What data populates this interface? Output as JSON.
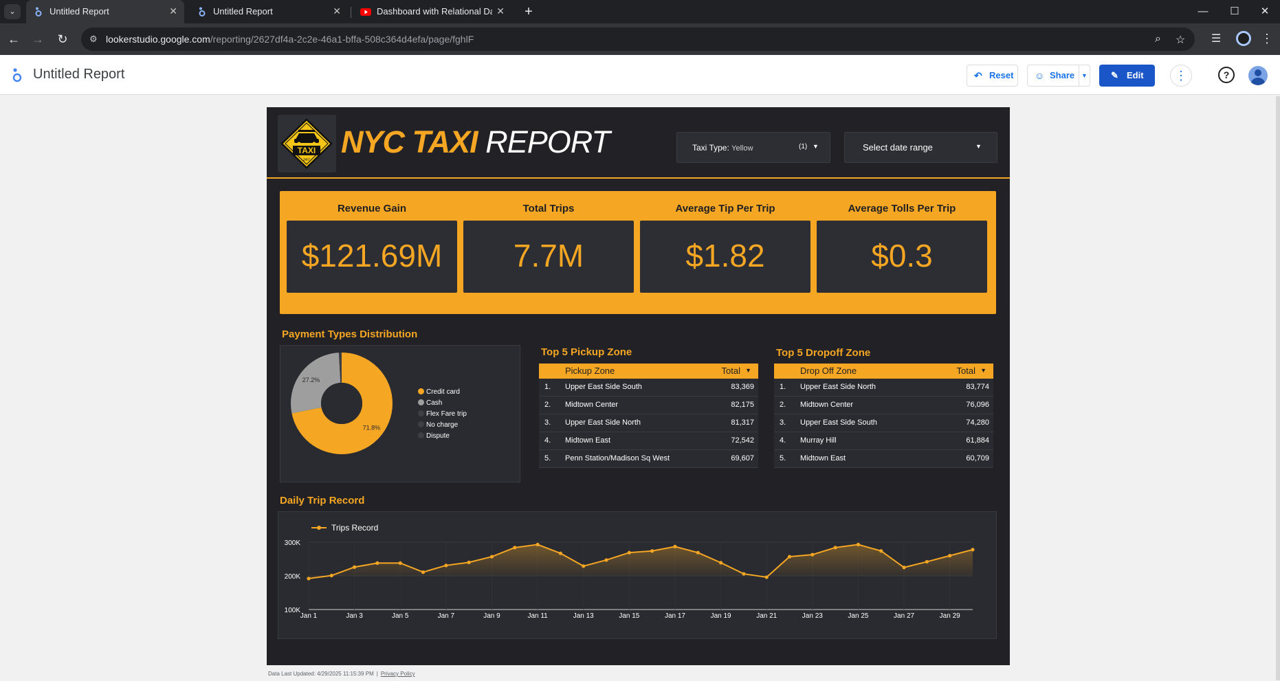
{
  "browser": {
    "tabs": [
      {
        "title": "Untitled Report",
        "active": true,
        "icon": "looker-studio-icon"
      },
      {
        "title": "Untitled Report",
        "active": false,
        "icon": "looker-studio-icon"
      },
      {
        "title": "Dashboard with Relational Data",
        "active": false,
        "icon": "youtube-icon"
      }
    ],
    "url_host": "lookerstudio.google.com",
    "url_path": "/reporting/2627df4a-2c2e-46a1-bffa-508c364d4efa/page/fghlF"
  },
  "app": {
    "title": "Untitled Report",
    "reset_label": "Reset",
    "share_label": "Share",
    "edit_label": "Edit",
    "accent_color": "#1a56c7"
  },
  "report": {
    "title_part1": "NYC TAXI",
    "title_part2": "REPORT",
    "logo_text": "TAXI",
    "logo_sub": "24/7",
    "accent_color": "#f5a623",
    "background_color": "#222226",
    "filters": {
      "taxi_type_label": "Taxi Type:",
      "taxi_type_value": "Yellow",
      "taxi_type_count": "(1)",
      "date_label": "Select date range"
    },
    "kpis": [
      {
        "label": "Revenue Gain",
        "value": "$121.69M"
      },
      {
        "label": "Total Trips",
        "value": "7.7M"
      },
      {
        "label": "Average Tip Per Trip",
        "value": "$1.82"
      },
      {
        "label": "Average Tolls Per Trip",
        "value": "$0.3"
      }
    ],
    "payment_title": "Payment Types Distribution",
    "pickup_title": "Top 5 Pickup Zone",
    "dropoff_title": "Top 5 Dropoff Zone",
    "pickup_table": {
      "col1": "Pickup Zone",
      "col2": "Total",
      "rows": [
        {
          "n": "1.",
          "zone": "Upper East Side South",
          "total": "83,369"
        },
        {
          "n": "2.",
          "zone": "Midtown Center",
          "total": "82,175"
        },
        {
          "n": "3.",
          "zone": "Upper East Side North",
          "total": "81,317"
        },
        {
          "n": "4.",
          "zone": "Midtown East",
          "total": "72,542"
        },
        {
          "n": "5.",
          "zone": "Penn Station/Madison Sq West",
          "total": "69,607"
        }
      ]
    },
    "dropoff_table": {
      "col1": "Drop Off Zone",
      "col2": "Total",
      "rows": [
        {
          "n": "1.",
          "zone": "Upper East Side North",
          "total": "83,774"
        },
        {
          "n": "2.",
          "zone": "Midtown Center",
          "total": "76,096"
        },
        {
          "n": "3.",
          "zone": "Upper East Side South",
          "total": "74,280"
        },
        {
          "n": "4.",
          "zone": "Murray Hill",
          "total": "61,884"
        },
        {
          "n": "5.",
          "zone": "Midtown East",
          "total": "60,709"
        }
      ]
    },
    "daily_title": "Daily Trip Record",
    "footer_updated": "Data Last Updated: 4/29/2025 11:15:39 PM",
    "footer_privacy": "Privacy Policy"
  },
  "chart_data": [
    {
      "type": "pie",
      "donut": true,
      "categories": [
        "Credit card",
        "Cash",
        "Flex Fare trip",
        "No charge",
        "Dispute"
      ],
      "values": [
        71.8,
        27.2,
        0.3,
        0.3,
        0.4
      ],
      "data_labels": [
        "71.8%",
        "27.2%"
      ],
      "colors": [
        "#f5a623",
        "#9e9e9e",
        "#3e3f45",
        "#3e3f45",
        "#3e3f45"
      ],
      "legend_position": "right"
    },
    {
      "type": "area",
      "series": [
        {
          "name": "Trips Record",
          "x": [
            "Jan 1",
            "Jan 2",
            "Jan 3",
            "Jan 4",
            "Jan 5",
            "Jan 6",
            "Jan 7",
            "Jan 8",
            "Jan 9",
            "Jan 10",
            "Jan 11",
            "Jan 12",
            "Jan 13",
            "Jan 14",
            "Jan 15",
            "Jan 16",
            "Jan 17",
            "Jan 18",
            "Jan 19",
            "Jan 20",
            "Jan 21",
            "Jan 22",
            "Jan 23",
            "Jan 24",
            "Jan 25",
            "Jan 26",
            "Jan 27",
            "Jan 28",
            "Jan 29",
            "Jan 30"
          ],
          "values": [
            192000,
            201000,
            226000,
            238000,
            238000,
            211000,
            231000,
            240000,
            257000,
            284000,
            293000,
            267000,
            229000,
            247000,
            269000,
            274000,
            287000,
            269000,
            239000,
            206000,
            196000,
            257000,
            263000,
            284000,
            293000,
            274000,
            225000,
            242000,
            260000,
            278000
          ]
        }
      ],
      "xticks": [
        "Jan 1",
        "Jan 3",
        "Jan 5",
        "Jan 7",
        "Jan 9",
        "Jan 11",
        "Jan 13",
        "Jan 15",
        "Jan 17",
        "Jan 19",
        "Jan 21",
        "Jan 23",
        "Jan 25",
        "Jan 27",
        "Jan 29"
      ],
      "yticks": [
        "100K",
        "200K",
        "300K"
      ],
      "ylim": [
        100000,
        300000
      ],
      "legend_position": "top-left",
      "grid": true,
      "color": "#f5a623"
    }
  ]
}
